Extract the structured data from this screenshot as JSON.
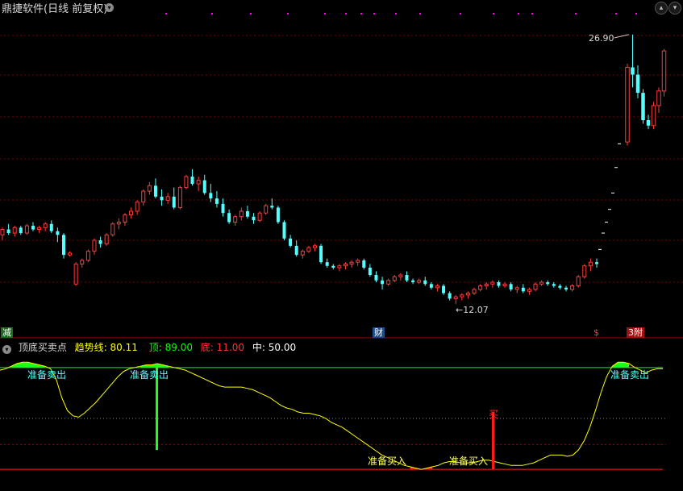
{
  "header": {
    "title": "鼎捷软件(日线 前复权)",
    "collapse_icon": "chevron-down-icon",
    "panel_buttons": [
      "chevron-up-icon",
      "chevron-down-icon"
    ]
  },
  "main_chart": {
    "high_label": "26.90",
    "low_label": "←12.07",
    "event_tags": {
      "left": "减",
      "middle": "财",
      "right_dollar": "$",
      "right": "3附"
    }
  },
  "indicator": {
    "collapse_icon": "chevron-down-icon",
    "name": "顶底买卖点",
    "trend_label": "趋势线",
    "trend_value": "80.11",
    "top_label": "顶",
    "top_value": "89.00",
    "bottom_label": "底",
    "bottom_value": "11.00",
    "mid_label": "中",
    "mid_value": "50.00",
    "sell_labels": [
      "准备卖出",
      "准备卖出",
      "准备卖出"
    ],
    "buy_labels": [
      "准备买入",
      "准备买入"
    ],
    "buy_signal": "买"
  },
  "colors": {
    "up": "#ff3b3b",
    "down": "#54ffff",
    "trend": "#ffff00",
    "top_line": "#00ff00",
    "bottom_line": "#ff2020",
    "grid": "#7a0000",
    "sell_fill": "#19ff19",
    "buy_fill": "#ff1a1a"
  },
  "chart_data": {
    "type": "candlestick",
    "price_range": [
      11.0,
      28.0
    ],
    "high_marker": 26.9,
    "low_marker": 12.07,
    "candles": [
      [
        15.9,
        16.3,
        15.6,
        16.2
      ],
      [
        16.2,
        16.5,
        15.9,
        16.0
      ],
      [
        16.0,
        16.4,
        15.8,
        16.3
      ],
      [
        16.3,
        16.4,
        15.9,
        16.0
      ],
      [
        16.0,
        16.5,
        15.9,
        16.4
      ],
      [
        16.4,
        16.6,
        16.1,
        16.2
      ],
      [
        16.2,
        16.4,
        16.0,
        16.3
      ],
      [
        16.3,
        16.6,
        16.1,
        16.5
      ],
      [
        16.5,
        16.7,
        16.0,
        16.1
      ],
      [
        16.1,
        16.3,
        15.5,
        15.9
      ],
      [
        15.9,
        16.0,
        14.6,
        14.8
      ],
      [
        14.8,
        15.0,
        14.7,
        14.9
      ],
      [
        13.2,
        14.4,
        13.1,
        14.3
      ],
      [
        14.3,
        14.6,
        14.1,
        14.5
      ],
      [
        14.5,
        15.1,
        14.4,
        15.0
      ],
      [
        15.0,
        15.7,
        14.8,
        15.6
      ],
      [
        15.6,
        15.8,
        15.2,
        15.4
      ],
      [
        15.4,
        16.0,
        15.3,
        15.9
      ],
      [
        15.9,
        16.6,
        15.8,
        16.5
      ],
      [
        16.5,
        16.8,
        16.2,
        16.6
      ],
      [
        16.6,
        17.1,
        16.4,
        17.0
      ],
      [
        17.0,
        17.4,
        16.8,
        17.2
      ],
      [
        17.2,
        17.8,
        17.0,
        17.7
      ],
      [
        17.7,
        18.4,
        17.5,
        18.3
      ],
      [
        18.3,
        18.8,
        18.1,
        18.6
      ],
      [
        18.6,
        19.0,
        17.9,
        18.0
      ],
      [
        18.0,
        18.4,
        17.5,
        17.8
      ],
      [
        17.8,
        18.2,
        17.6,
        18.0
      ],
      [
        18.0,
        18.5,
        17.3,
        17.4
      ],
      [
        17.4,
        18.6,
        17.3,
        18.5
      ],
      [
        18.5,
        19.2,
        18.4,
        19.1
      ],
      [
        19.1,
        19.5,
        18.6,
        18.7
      ],
      [
        18.7,
        19.1,
        18.3,
        18.9
      ],
      [
        18.9,
        19.2,
        18.1,
        18.2
      ],
      [
        18.2,
        18.7,
        17.7,
        17.9
      ],
      [
        17.9,
        18.3,
        17.4,
        17.6
      ],
      [
        17.6,
        17.9,
        16.9,
        17.1
      ],
      [
        17.1,
        17.3,
        16.5,
        16.6
      ],
      [
        16.6,
        17.0,
        16.4,
        16.9
      ],
      [
        16.9,
        17.4,
        16.7,
        17.2
      ],
      [
        17.2,
        17.5,
        16.8,
        16.9
      ],
      [
        16.9,
        17.1,
        16.5,
        16.7
      ],
      [
        16.7,
        17.2,
        16.6,
        17.1
      ],
      [
        17.1,
        17.6,
        17.0,
        17.5
      ],
      [
        17.5,
        17.9,
        17.3,
        17.4
      ],
      [
        17.4,
        17.5,
        16.5,
        16.6
      ],
      [
        16.6,
        16.7,
        15.6,
        15.7
      ],
      [
        15.7,
        15.9,
        15.2,
        15.3
      ],
      [
        15.3,
        15.6,
        14.7,
        14.8
      ],
      [
        14.8,
        15.1,
        14.6,
        15.0
      ],
      [
        15.0,
        15.3,
        14.9,
        15.2
      ],
      [
        15.2,
        15.4,
        15.0,
        15.3
      ],
      [
        15.3,
        15.4,
        14.3,
        14.4
      ],
      [
        14.4,
        14.6,
        14.1,
        14.2
      ],
      [
        14.2,
        14.3,
        14.0,
        14.1
      ],
      [
        14.1,
        14.3,
        13.9,
        14.2
      ],
      [
        14.2,
        14.4,
        14.0,
        14.3
      ],
      [
        14.3,
        14.5,
        14.1,
        14.4
      ],
      [
        14.4,
        14.6,
        14.2,
        14.5
      ],
      [
        14.5,
        14.6,
        14.0,
        14.1
      ],
      [
        14.1,
        14.3,
        13.6,
        13.7
      ],
      [
        13.7,
        13.9,
        13.3,
        13.4
      ],
      [
        13.4,
        13.6,
        12.9,
        13.2
      ],
      [
        13.2,
        13.5,
        13.1,
        13.4
      ],
      [
        13.4,
        13.7,
        13.3,
        13.6
      ],
      [
        13.6,
        13.8,
        13.4,
        13.7
      ],
      [
        13.7,
        13.9,
        13.3,
        13.4
      ],
      [
        13.4,
        13.5,
        13.2,
        13.3
      ],
      [
        13.3,
        13.5,
        13.2,
        13.4
      ],
      [
        13.4,
        13.6,
        13.1,
        13.2
      ],
      [
        13.2,
        13.3,
        12.9,
        13.0
      ],
      [
        13.0,
        13.2,
        12.8,
        13.1
      ],
      [
        13.1,
        13.2,
        12.6,
        12.7
      ],
      [
        12.7,
        12.8,
        12.3,
        12.4
      ],
      [
        12.4,
        12.6,
        12.1,
        12.5
      ],
      [
        12.5,
        12.7,
        12.3,
        12.6
      ],
      [
        12.6,
        12.8,
        12.4,
        12.7
      ],
      [
        12.7,
        13.0,
        12.6,
        12.9
      ],
      [
        12.9,
        13.2,
        12.8,
        13.1
      ],
      [
        13.1,
        13.3,
        12.9,
        13.2
      ],
      [
        13.2,
        13.4,
        13.0,
        13.3
      ],
      [
        13.3,
        13.4,
        13.0,
        13.1
      ],
      [
        13.1,
        13.3,
        13.0,
        13.2
      ],
      [
        13.2,
        13.3,
        12.8,
        12.9
      ],
      [
        12.9,
        13.1,
        12.7,
        13.0
      ],
      [
        13.0,
        13.2,
        12.7,
        12.8
      ],
      [
        12.8,
        13.0,
        12.6,
        12.9
      ],
      [
        12.9,
        13.3,
        12.8,
        13.2
      ],
      [
        13.2,
        13.4,
        13.1,
        13.3
      ],
      [
        13.3,
        13.4,
        13.1,
        13.2
      ],
      [
        13.2,
        13.3,
        13.0,
        13.1
      ],
      [
        13.1,
        13.2,
        12.9,
        13.0
      ],
      [
        13.0,
        13.1,
        12.8,
        12.9
      ],
      [
        12.9,
        13.2,
        12.8,
        13.1
      ],
      [
        13.1,
        13.7,
        13.0,
        13.6
      ],
      [
        13.6,
        14.3,
        13.5,
        14.2
      ],
      [
        14.2,
        14.6,
        13.9,
        14.4
      ],
      [
        14.4,
        14.6,
        14.1,
        14.3
      ]
    ],
    "recovery_ticks": [
      15.1,
      16.0,
      16.6,
      17.3,
      18.2,
      19.6,
      20.9
    ],
    "spike_candles": [
      [
        21.0,
        25.3,
        20.8,
        25.1
      ],
      [
        25.1,
        26.9,
        24.0,
        24.7
      ],
      [
        24.7,
        25.2,
        23.4,
        23.7
      ],
      [
        23.7,
        23.9,
        22.0,
        22.2
      ],
      [
        22.2,
        22.5,
        21.7,
        21.9
      ],
      [
        21.9,
        23.2,
        21.7,
        23.0
      ],
      [
        23.0,
        24.0,
        22.6,
        23.8
      ],
      [
        23.8,
        26.1,
        23.5,
        26.0
      ]
    ],
    "indicator_range": [
      0,
      100
    ],
    "reference_lines": {
      "top": 89.0,
      "bottom": 11.0,
      "mid": 50.0
    },
    "trend_values": [
      87,
      88,
      90,
      92,
      93,
      93,
      92,
      91,
      90,
      88,
      80,
      66,
      56,
      52,
      51,
      54,
      58,
      62,
      67,
      72,
      77,
      82,
      86,
      88,
      89,
      90,
      91,
      91,
      92,
      91,
      90,
      89,
      88,
      87,
      85,
      83,
      81,
      79,
      77,
      75,
      74,
      74,
      74,
      74,
      73,
      72,
      70,
      68,
      66,
      63,
      60,
      58,
      57,
      55,
      54,
      54,
      53,
      52,
      50,
      47,
      45,
      43,
      40,
      37,
      34,
      31,
      28,
      25,
      22,
      20,
      18,
      16,
      14,
      13,
      12,
      11,
      12,
      13,
      14,
      16,
      17,
      17,
      16,
      16,
      16,
      17,
      18,
      18,
      17,
      16,
      15,
      14,
      14,
      14,
      15,
      16,
      18,
      20,
      22,
      22,
      22,
      21,
      22,
      26,
      33,
      43,
      56,
      70,
      82,
      90,
      93,
      93,
      92,
      89,
      87,
      85,
      87,
      88,
      88
    ],
    "buy_signal_value": 37
  }
}
